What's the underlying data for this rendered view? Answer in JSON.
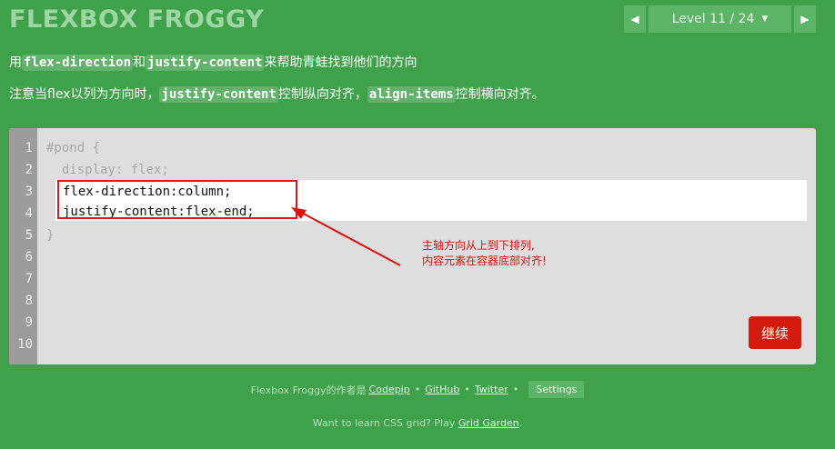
{
  "header": {
    "logo": "FLEXBOX FROGGY",
    "level_text": "Level 11 / 24",
    "prev_label": "◀",
    "next_label": "▶",
    "dropdown_label": "▼"
  },
  "instructions": {
    "line1": {
      "p1": "用",
      "c1": "flex-direction",
      "p2": "和",
      "c2": "justify-content",
      "p3": "来帮助青蛙找到他们的方向"
    },
    "line2": {
      "p1": "注意当flex以列为方向时，",
      "c1": "justify-content",
      "p2": "控制纵向对齐，",
      "c2": "align-items",
      "p3": "控制横向对齐。"
    }
  },
  "editor": {
    "line_numbers": [
      "1",
      "2",
      "3",
      "4",
      "5",
      "6",
      "7",
      "8",
      "9",
      "10"
    ],
    "code": {
      "l1": "#pond {",
      "l2": "  display: flex;",
      "l5": "}"
    },
    "input_lines": [
      "flex-direction:column;",
      "justify-content:flex-end;"
    ],
    "next_button": "继续"
  },
  "annotation": {
    "line1": "主轴方向从上到下排列,",
    "line2": "内容元素在容器底部对齐!",
    "color": "#e01010"
  },
  "footer": {
    "credits_prefix": "Flexbox Froggy的作者是",
    "codepip": "Codepip",
    "bullet": "•",
    "github": "GitHub",
    "twitter": "Twitter",
    "settings": "Settings",
    "grid_prefix": "Want to learn CSS grid? Play",
    "grid_link": "Grid Garden",
    "grid_suffix": "."
  },
  "colors": {
    "background": "#3fa14a",
    "editor_bg": "#dedede",
    "gutter": "#9c9c9c",
    "accent_red": "#d21b0c"
  }
}
